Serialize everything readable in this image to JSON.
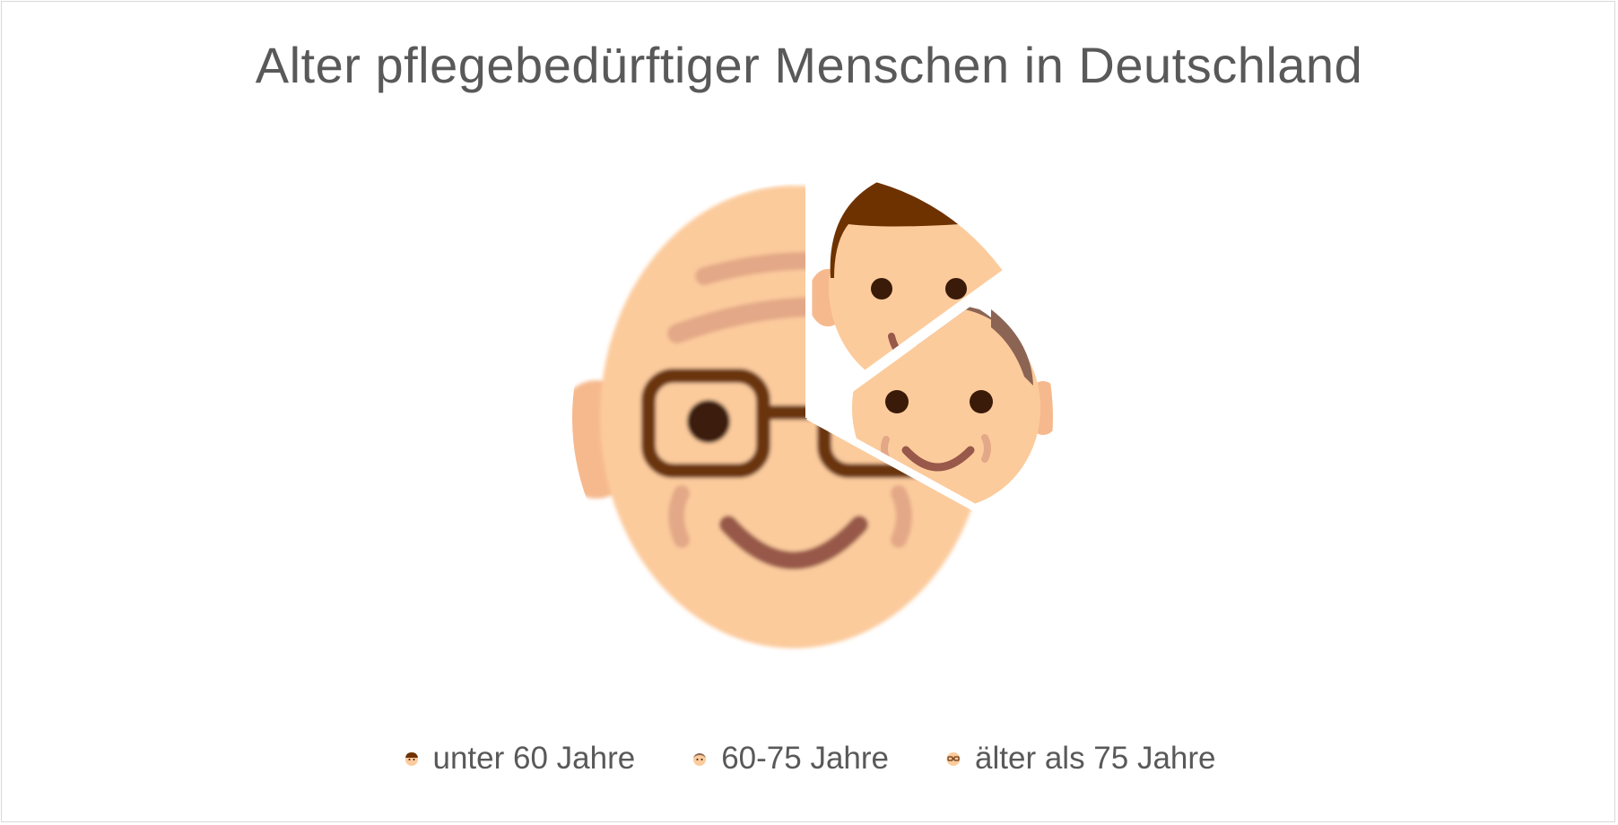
{
  "chart_data": {
    "type": "pie",
    "title": "Alter pflegebedürftiger Menschen in Deutschland",
    "categories": [
      "unter 60 Jahre",
      "60-75 Jahre",
      "älter als 75 Jahre"
    ],
    "values": [
      15,
      18,
      67
    ],
    "start_angle_deg": 0,
    "direction": "clockwise",
    "legend_position": "bottom",
    "slice_icons": [
      "young-man-face-icon",
      "older-man-face-icon",
      "elderly-man-with-glasses-face-icon"
    ],
    "exploded": [
      true,
      true,
      false
    ]
  },
  "colors": {
    "skin": "#fccb9c",
    "ear": "#f6b98d",
    "hair_dark": "#6e3200",
    "hair_gray": "#8c6454",
    "eyes": "#3a1a08",
    "mouth": "#98584a",
    "wrinkle": "#e3a887",
    "glasses": "#6a3610",
    "title_text": "#595959",
    "separator": "#ffffff"
  }
}
